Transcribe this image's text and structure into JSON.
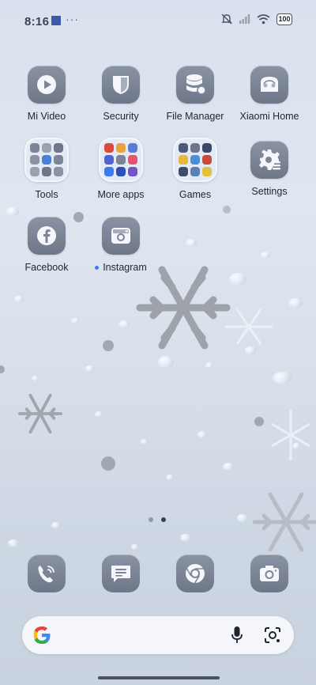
{
  "status_bar": {
    "time": "8:16",
    "more": "···",
    "battery": "100",
    "icons": [
      "notification-square-icon",
      "silent-bell-icon",
      "cell-signal-icon",
      "wifi-icon",
      "battery-icon"
    ]
  },
  "apps": [
    {
      "label": "Mi Video",
      "icon": "play-icon"
    },
    {
      "label": "Security",
      "icon": "shield-icon"
    },
    {
      "label": "File Manager",
      "icon": "database-icon"
    },
    {
      "label": "Xiaomi Home",
      "icon": "xiaomi-home-icon"
    },
    {
      "label": "Tools",
      "icon": "folder-icon"
    },
    {
      "label": "More apps",
      "icon": "folder-icon"
    },
    {
      "label": "Games",
      "icon": "folder-icon"
    },
    {
      "label": "Settings",
      "icon": "gear-icon"
    },
    {
      "label": "Facebook",
      "icon": "facebook-icon"
    },
    {
      "label": "Instagram",
      "icon": "instagram-icon",
      "new_indicator": true
    }
  ],
  "pagination": {
    "pages": 2,
    "current": 2
  },
  "dock": [
    "phone-icon",
    "messages-icon",
    "chrome-icon",
    "camera-icon"
  ],
  "search": {
    "icons": [
      "google-g-icon",
      "mic-icon",
      "lens-icon"
    ]
  },
  "colors": {
    "icon_tile": "#7c8597",
    "accent": "#3b7bf0",
    "background": "#d9e1ee"
  }
}
